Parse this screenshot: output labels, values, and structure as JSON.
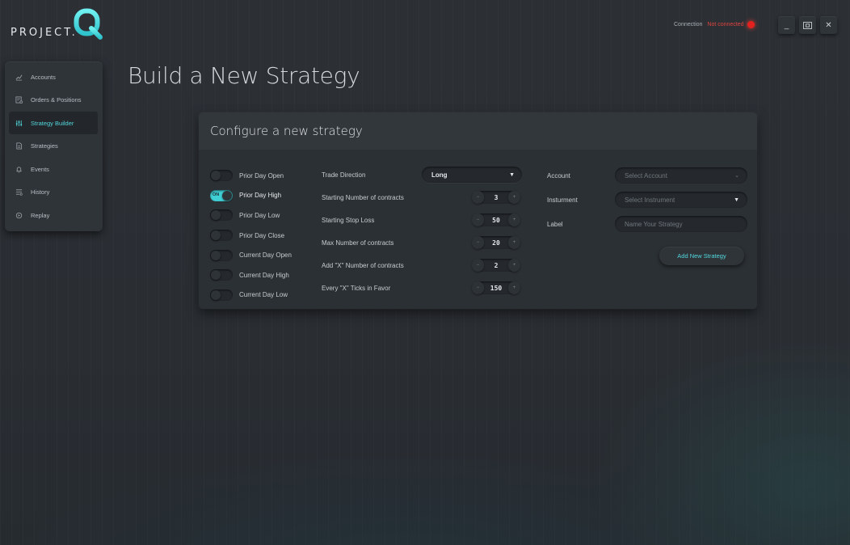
{
  "app": {
    "logo_text": "PROJECT.",
    "logo_letter": "Q"
  },
  "connection": {
    "label": "Connection",
    "status": "Not connected",
    "status_color": "#e3211f"
  },
  "window_controls": {
    "minimize": "_",
    "maximize": "⛶",
    "close": "✕"
  },
  "sidebar": {
    "items": [
      {
        "label": "Accounts",
        "icon": "chart-icon",
        "active": false
      },
      {
        "label": "Orders & Positions",
        "icon": "orders-icon",
        "active": false
      },
      {
        "label": "Strategy Builder",
        "icon": "settings-icon",
        "active": true
      },
      {
        "label": "Strategies",
        "icon": "document-icon",
        "active": false
      },
      {
        "label": "Events",
        "icon": "bell-icon",
        "active": false
      },
      {
        "label": "History",
        "icon": "history-icon",
        "active": false
      },
      {
        "label": "Replay",
        "icon": "replay-icon",
        "active": false
      }
    ]
  },
  "page": {
    "title": "Build a New Strategy"
  },
  "card": {
    "title": "Configure a new strategy",
    "toggles": [
      {
        "label": "Prior Day Open",
        "on": false
      },
      {
        "label": "Prior Day High",
        "on": true,
        "on_text": "ON"
      },
      {
        "label": "Prior Day Low",
        "on": false
      },
      {
        "label": "Prior Day Close",
        "on": false
      },
      {
        "label": "Current Day Open",
        "on": false
      },
      {
        "label": "Current Day High",
        "on": false
      },
      {
        "label": "Current Day Low",
        "on": false
      }
    ],
    "trade_direction": {
      "label": "Trade Direction",
      "value": "Long"
    },
    "steppers": [
      {
        "label": "Starting Number of contracts",
        "value": "3"
      },
      {
        "label": "Starting Stop Loss",
        "value": "50"
      },
      {
        "label": "Max Number of contracts",
        "value": "20"
      },
      {
        "label": "Add \"X\" Number of contracts",
        "value": "2"
      },
      {
        "label": "Every \"X\" Ticks in Favor",
        "value": "150"
      }
    ],
    "stepper_minus": "−",
    "stepper_plus": "+",
    "account": {
      "label": "Account",
      "placeholder": "Select Account"
    },
    "instrument": {
      "label": "Insturment",
      "placeholder": "Select Instrument"
    },
    "strategy_label": {
      "label": "Label",
      "placeholder": "Name Your Strategy"
    },
    "add_button": "Add New Strategy"
  },
  "colors": {
    "accent": "#52d7dd",
    "background": "#2c3035",
    "panel": "#2f3439"
  }
}
